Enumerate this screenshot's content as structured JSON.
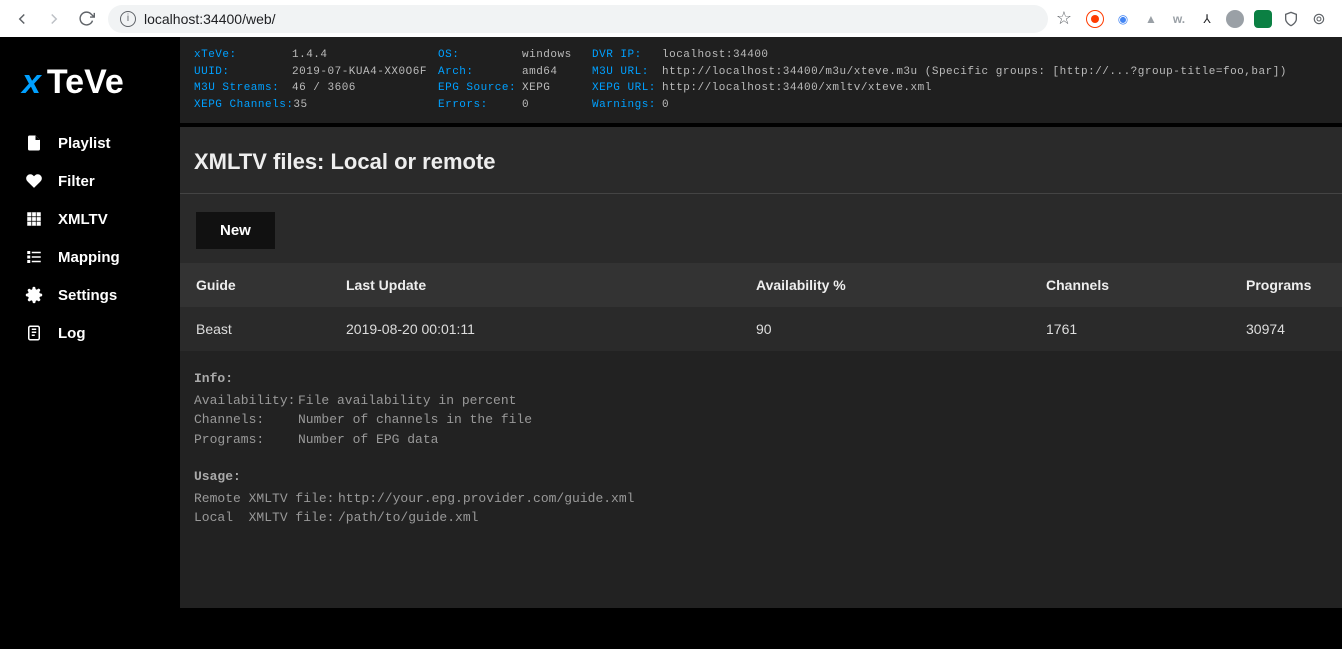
{
  "browser": {
    "url": "localhost:34400/web/"
  },
  "logo": {
    "x": "x",
    "teve": "TeVe"
  },
  "sidebar": {
    "items": [
      {
        "label": "Playlist",
        "icon": "file-icon"
      },
      {
        "label": "Filter",
        "icon": "heart-icon"
      },
      {
        "label": "XMLTV",
        "icon": "grid-icon"
      },
      {
        "label": "Mapping",
        "icon": "list-icon"
      },
      {
        "label": "Settings",
        "icon": "gear-icon"
      },
      {
        "label": "Log",
        "icon": "clipboard-icon"
      }
    ]
  },
  "status": {
    "rows": [
      [
        {
          "k": "xTeVe:",
          "v": "1.4.4"
        },
        {
          "k": "OS:",
          "v": "windows"
        },
        {
          "k": "DVR IP:",
          "v": "localhost:34400"
        }
      ],
      [
        {
          "k": "UUID:",
          "v": "2019-07-KUA4-XX0O6F"
        },
        {
          "k": "Arch:",
          "v": "amd64"
        },
        {
          "k": "M3U URL:",
          "v": "http://localhost:34400/m3u/xteve.m3u (Specific groups: [http://...?group-title=foo,bar])"
        }
      ],
      [
        {
          "k": "M3U Streams:",
          "v": "46 / 3606"
        },
        {
          "k": "EPG Source:",
          "v": "XEPG"
        },
        {
          "k": "XEPG URL:",
          "v": "http://localhost:34400/xmltv/xteve.xml"
        }
      ],
      [
        {
          "k": "XEPG Channels:",
          "v": "35"
        },
        {
          "k": "Errors:",
          "v": "0"
        },
        {
          "k": "Warnings:",
          "v": "0"
        }
      ]
    ]
  },
  "page": {
    "title": "XMLTV files: Local or remote",
    "new_button": "New",
    "table": {
      "headers": [
        "Guide",
        "Last Update",
        "Availability %",
        "Channels",
        "Programs"
      ],
      "rows": [
        [
          "Beast",
          "2019-08-20 00:01:11",
          "90",
          "1761",
          "30974"
        ]
      ]
    },
    "info": {
      "info_heading": "Info:",
      "lines": [
        {
          "k": "Availability:",
          "v": "File availability in percent"
        },
        {
          "k": "Channels:",
          "v": "Number of channels in the file"
        },
        {
          "k": "Programs:",
          "v": "Number of EPG data"
        }
      ],
      "usage_heading": "Usage:",
      "usage_lines": [
        {
          "k": "Remote XMLTV file:",
          "v": "http://your.epg.provider.com/guide.xml"
        },
        {
          "k": "Local  XMLTV file:",
          "v": "/path/to/guide.xml"
        }
      ]
    }
  }
}
